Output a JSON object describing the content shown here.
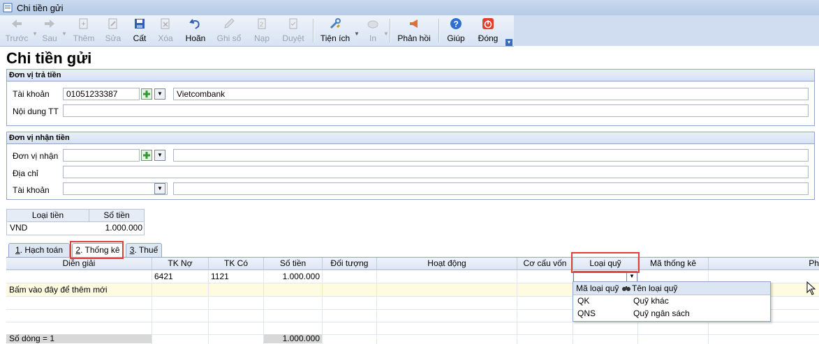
{
  "window": {
    "title": "Chi tiền gửi"
  },
  "toolbar": {
    "buttons": [
      {
        "label": "Trước",
        "icon": "arrow-left-icon"
      },
      {
        "label": "Sau",
        "icon": "arrow-right-icon"
      },
      {
        "label": "Thêm",
        "icon": "add-document-icon"
      },
      {
        "label": "Sửa",
        "icon": "edit-document-icon"
      },
      {
        "label": "Cất",
        "icon": "save-icon"
      },
      {
        "label": "Xóa",
        "icon": "delete-icon"
      },
      {
        "label": "Hoãn",
        "icon": "undo-icon"
      },
      {
        "label": "Ghi sổ",
        "icon": "pencil-icon"
      },
      {
        "label": "Nạp",
        "icon": "load-icon"
      },
      {
        "label": "Duyệt",
        "icon": "approve-icon"
      },
      {
        "label": "Tiện ích",
        "icon": "tools-icon"
      },
      {
        "label": "In",
        "icon": "print-icon"
      },
      {
        "label": "Phản hồi",
        "icon": "megaphone-icon"
      },
      {
        "label": "Giúp",
        "icon": "help-icon"
      },
      {
        "label": "Đóng",
        "icon": "power-icon"
      }
    ]
  },
  "page": {
    "title": "Chi tiền gửi"
  },
  "payer": {
    "heading": "Đơn vị trả tiền",
    "account_label": "Tài khoản",
    "account_value": "01051233387",
    "bank_value": "Vietcombank",
    "content_label": "Nội dung TT",
    "content_value": ""
  },
  "payee": {
    "heading": "Đơn vị nhận tiền",
    "unit_label": "Đơn vị nhận",
    "address_label": "Địa chỉ",
    "account_label": "Tài khoản"
  },
  "currency": {
    "headers": [
      "Loại tiền",
      "Số tiền"
    ],
    "currency": "VND",
    "amount": "1.000.000"
  },
  "tabs": [
    {
      "num": "1",
      "label": ". Hạch toán"
    },
    {
      "num": "2",
      "label": ". Thống kê"
    },
    {
      "num": "3",
      "label": ". Thuế"
    }
  ],
  "grid": {
    "headers": [
      "Diễn giải",
      "TK Nợ",
      "TK Có",
      "Số tiền",
      "Đối tượng",
      "Hoạt động",
      "Cơ cấu vốn",
      "Loại quỹ",
      "Mã thống kê",
      "Ph"
    ],
    "row1": {
      "debit": "6421",
      "credit": "1121",
      "amount": "1.000.000"
    },
    "new_row_hint": "Bấm vào đây để thêm mới",
    "footer_count": "Số dòng = 1",
    "footer_sum": "1.000.000"
  },
  "fund_popup": {
    "headers": [
      "Mã loại quỹ",
      "Tên loại quỹ"
    ],
    "options": [
      {
        "code": "QK",
        "name": "Quỹ khác"
      },
      {
        "code": "QNS",
        "name": "Quỹ ngân sách"
      }
    ]
  }
}
